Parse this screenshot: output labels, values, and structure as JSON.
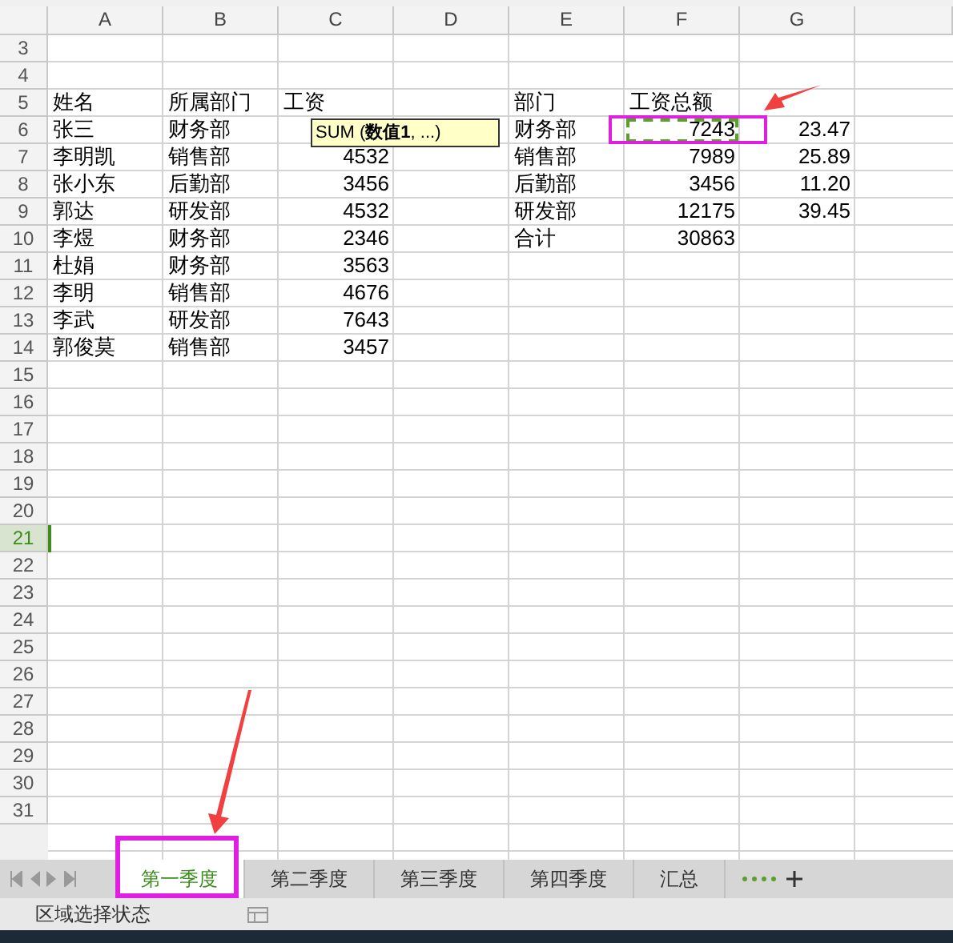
{
  "columns": [
    "A",
    "B",
    "C",
    "D",
    "E",
    "F",
    "G",
    ""
  ],
  "rows": [
    {
      "number": "3",
      "selected": false,
      "cells": []
    },
    {
      "number": "4",
      "selected": false,
      "cells": []
    },
    {
      "number": "5",
      "selected": false,
      "cells": [
        {
          "text": "姓名",
          "kind": "text"
        },
        {
          "text": "所属部门",
          "kind": "text"
        },
        {
          "text": "工资",
          "kind": "text"
        },
        null,
        {
          "text": "部门",
          "kind": "text"
        },
        {
          "text": "工资总额",
          "kind": "text"
        }
      ]
    },
    {
      "number": "6",
      "selected": false,
      "cells": [
        {
          "text": "张三",
          "kind": "text"
        },
        {
          "text": "财务部",
          "kind": "text"
        },
        null,
        null,
        {
          "text": "财务部",
          "kind": "text"
        },
        {
          "text": "7243",
          "kind": "number",
          "marquee": true
        },
        {
          "text": "23.47",
          "kind": "number"
        }
      ]
    },
    {
      "number": "7",
      "selected": false,
      "cells": [
        {
          "text": "李明凯",
          "kind": "text"
        },
        {
          "text": "销售部",
          "kind": "text"
        },
        {
          "text": "4532",
          "kind": "number"
        },
        null,
        {
          "text": "销售部",
          "kind": "text"
        },
        {
          "text": "7989",
          "kind": "number"
        },
        {
          "text": "25.89",
          "kind": "number"
        }
      ]
    },
    {
      "number": "8",
      "selected": false,
      "cells": [
        {
          "text": "张小东",
          "kind": "text"
        },
        {
          "text": "后勤部",
          "kind": "text"
        },
        {
          "text": "3456",
          "kind": "number"
        },
        null,
        {
          "text": "后勤部",
          "kind": "text"
        },
        {
          "text": "3456",
          "kind": "number"
        },
        {
          "text": "11.20",
          "kind": "number"
        }
      ]
    },
    {
      "number": "9",
      "selected": false,
      "cells": [
        {
          "text": "郭达",
          "kind": "text"
        },
        {
          "text": "研发部",
          "kind": "text"
        },
        {
          "text": "4532",
          "kind": "number"
        },
        null,
        {
          "text": "研发部",
          "kind": "text"
        },
        {
          "text": "12175",
          "kind": "number"
        },
        {
          "text": "39.45",
          "kind": "number"
        }
      ]
    },
    {
      "number": "10",
      "selected": false,
      "cells": [
        {
          "text": "李煜",
          "kind": "text"
        },
        {
          "text": "财务部",
          "kind": "text"
        },
        {
          "text": "2346",
          "kind": "number"
        },
        null,
        {
          "text": "合计",
          "kind": "text"
        },
        {
          "text": "30863",
          "kind": "number"
        }
      ]
    },
    {
      "number": "11",
      "selected": false,
      "cells": [
        {
          "text": "杜娟",
          "kind": "text"
        },
        {
          "text": "财务部",
          "kind": "text"
        },
        {
          "text": "3563",
          "kind": "number"
        }
      ]
    },
    {
      "number": "12",
      "selected": false,
      "cells": [
        {
          "text": "李明",
          "kind": "text"
        },
        {
          "text": "销售部",
          "kind": "text"
        },
        {
          "text": "4676",
          "kind": "number"
        }
      ]
    },
    {
      "number": "13",
      "selected": false,
      "cells": [
        {
          "text": "李武",
          "kind": "text"
        },
        {
          "text": "研发部",
          "kind": "text"
        },
        {
          "text": "7643",
          "kind": "number"
        }
      ]
    },
    {
      "number": "14",
      "selected": false,
      "cells": [
        {
          "text": "郭俊莫",
          "kind": "text"
        },
        {
          "text": "销售部",
          "kind": "text"
        },
        {
          "text": "3457",
          "kind": "number"
        }
      ]
    },
    {
      "number": "15",
      "selected": false,
      "cells": []
    },
    {
      "number": "16",
      "selected": false,
      "cells": []
    },
    {
      "number": "17",
      "selected": false,
      "cells": []
    },
    {
      "number": "18",
      "selected": false,
      "cells": []
    },
    {
      "number": "19",
      "selected": false,
      "cells": []
    },
    {
      "number": "20",
      "selected": false,
      "cells": []
    },
    {
      "number": "21",
      "selected": true,
      "cells": []
    },
    {
      "number": "22",
      "selected": false,
      "cells": []
    },
    {
      "number": "23",
      "selected": false,
      "cells": []
    },
    {
      "number": "24",
      "selected": false,
      "cells": []
    },
    {
      "number": "25",
      "selected": false,
      "cells": []
    },
    {
      "number": "26",
      "selected": false,
      "cells": []
    },
    {
      "number": "27",
      "selected": false,
      "cells": []
    },
    {
      "number": "28",
      "selected": false,
      "cells": []
    },
    {
      "number": "29",
      "selected": false,
      "cells": []
    },
    {
      "number": "30",
      "selected": false,
      "cells": []
    },
    {
      "number": "31",
      "selected": false,
      "cells": []
    }
  ],
  "tooltip": "SUM (**数值1**, ...)",
  "sheet_tabs": [
    {
      "label": "第一季度",
      "selected": true
    },
    {
      "label": "第二季度",
      "selected": false
    },
    {
      "label": "第三季度",
      "selected": false
    },
    {
      "label": "第四季度",
      "selected": false
    },
    {
      "label": "汇总",
      "selected": false
    }
  ],
  "status_bar": {
    "text": "区域选择状态"
  }
}
